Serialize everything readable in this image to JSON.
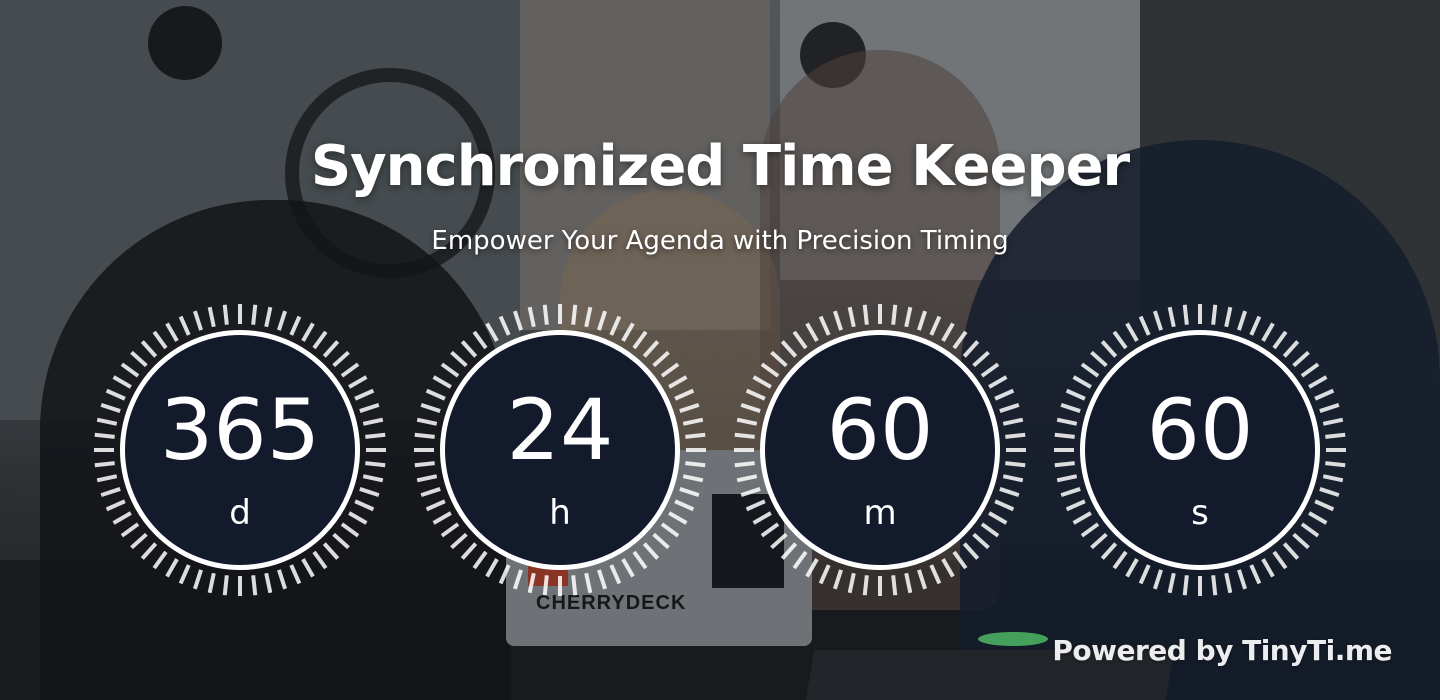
{
  "header": {
    "title": "Synchronized Time Keeper",
    "subtitle": "Empower Your Agenda with Precision Timing"
  },
  "counters": [
    {
      "value": "365",
      "unit": "d"
    },
    {
      "value": "24",
      "unit": "h"
    },
    {
      "value": "60",
      "unit": "m"
    },
    {
      "value": "60",
      "unit": "s"
    }
  ],
  "background": {
    "laptop_sticker_text": "CHERRYDECK"
  },
  "footer": {
    "powered_by": "Powered by TinyTi.me"
  },
  "colors": {
    "counter_face": "#121a2c",
    "counter_ring": "#ffffff",
    "text": "#ffffff"
  }
}
